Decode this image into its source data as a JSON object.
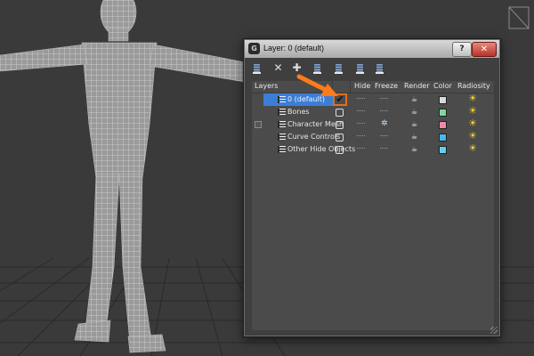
{
  "window": {
    "title": "Layer: 0 (default)",
    "app_icon": "G",
    "help_label": "?",
    "close_label": "✕"
  },
  "toolbar": {
    "buttons": [
      {
        "name": "create-layer-icon",
        "glyph": "≣"
      },
      {
        "name": "delete-layer-icon",
        "glyph": "✕"
      },
      {
        "name": "add-to-layer-icon",
        "glyph": "✚"
      },
      {
        "name": "select-in-layer-icon",
        "glyph": "≣"
      },
      {
        "name": "highlight-layer-icon",
        "glyph": "≣"
      },
      {
        "name": "hide-all-layers-icon",
        "glyph": "≣"
      },
      {
        "name": "freeze-all-layers-icon",
        "glyph": "≣"
      }
    ]
  },
  "columns": {
    "layers": "Layers",
    "hide": "Hide",
    "freeze": "Freeze",
    "render": "Render",
    "color": "Color",
    "radiosity": "Radiosity"
  },
  "layers": [
    {
      "name": "0 (default)",
      "selected": true,
      "current": true,
      "check": "✔",
      "expander": false,
      "frozen": false,
      "color": "#d9d9d9"
    },
    {
      "name": "Bones",
      "selected": false,
      "current": false,
      "check": "",
      "expander": false,
      "frozen": false,
      "color": "#7fd89a"
    },
    {
      "name": "Character Mesh",
      "selected": false,
      "current": false,
      "check": "",
      "expander": true,
      "frozen": true,
      "color": "#e98aa7"
    },
    {
      "name": "Curve Controls",
      "selected": false,
      "current": false,
      "check": "",
      "expander": false,
      "frozen": false,
      "color": "#46b9e6"
    },
    {
      "name": "Other Hide Objects",
      "selected": false,
      "current": false,
      "check": "",
      "expander": false,
      "frozen": false,
      "color": "#5fd4e8"
    }
  ],
  "icons": {
    "freeze_glyph": "✲",
    "render_glyph": "☕",
    "radiosity_glyph": "☀"
  },
  "colors": {
    "selection": "#3c7ed6",
    "highlight_border": "#e36d1f",
    "arrow": "#ff7a1a"
  }
}
